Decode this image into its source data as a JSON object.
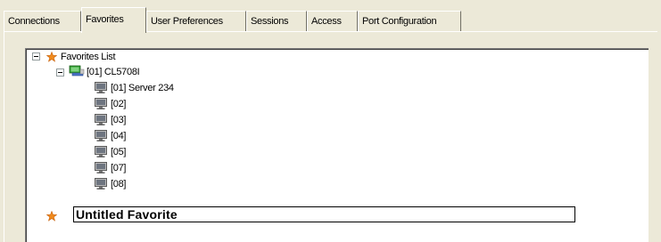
{
  "tabs": [
    {
      "label": "Connections",
      "active": false
    },
    {
      "label": "Favorites",
      "active": true
    },
    {
      "label": "User Preferences",
      "active": false
    },
    {
      "label": "Sessions",
      "active": false
    },
    {
      "label": "Access",
      "active": false
    },
    {
      "label": "Port Configuration",
      "active": false
    }
  ],
  "tree": {
    "root": {
      "label": "Favorites List",
      "icon": "star-icon",
      "expanded": true
    },
    "switch": {
      "label": "[01] CL5708I",
      "icon": "network-computer-icon",
      "expanded": true
    },
    "ports": [
      {
        "label": "[01] Server 234",
        "icon": "monitor-icon"
      },
      {
        "label": "[02]",
        "icon": "monitor-icon"
      },
      {
        "label": "[03]",
        "icon": "monitor-icon"
      },
      {
        "label": "[04]",
        "icon": "monitor-icon"
      },
      {
        "label": "[05]",
        "icon": "monitor-icon"
      },
      {
        "label": "[07]",
        "icon": "monitor-icon"
      },
      {
        "label": "[08]",
        "icon": "monitor-icon"
      }
    ],
    "new_favorite": {
      "value": "Untitled Favorite",
      "icon": "star-icon"
    }
  },
  "colors": {
    "star": "#f08a1c",
    "window_bg": "#ece9d8",
    "network_green": "#2f9e2f"
  }
}
